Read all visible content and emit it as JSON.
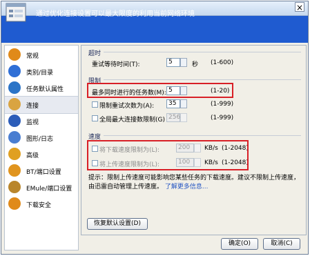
{
  "window": {
    "title": "配置",
    "close_glyph": "×"
  },
  "banner": {
    "text": "通过优化连接设置可以最大限度的利用当前网络环境",
    "icon": "settings-panel-icon"
  },
  "sidebar": {
    "items": [
      {
        "label": "常规",
        "icon": "general-icon",
        "color": "#e08a1a"
      },
      {
        "label": "类别/目录",
        "icon": "folder-icon",
        "color": "#2f6fd6"
      },
      {
        "label": "任务默认属性",
        "icon": "properties-icon",
        "color": "#2b74c7"
      },
      {
        "label": "连接",
        "icon": "connection-icon",
        "color": "#d9a441"
      },
      {
        "label": "监视",
        "icon": "monitor-icon",
        "color": "#2c5db9"
      },
      {
        "label": "图形/日志",
        "icon": "chart-icon",
        "color": "#4a7ed1"
      },
      {
        "label": "高级",
        "icon": "advanced-icon",
        "color": "#e0a021"
      },
      {
        "label": "BT/端口设置",
        "icon": "bt-icon",
        "color": "#e0941e"
      },
      {
        "label": "EMule/端口设置",
        "icon": "emule-icon",
        "color": "#b9862c"
      },
      {
        "label": "下载安全",
        "icon": "shield-icon",
        "color": "#e08a1a"
      }
    ],
    "selected_index": 3
  },
  "timeout": {
    "section": "超时",
    "retry_label": "重试等待时间(T):",
    "retry_value": "5",
    "unit": "秒",
    "range": "(1-600)"
  },
  "limits": {
    "section": "限制",
    "max_tasks_label": "最多同时进行的任务数(M):",
    "max_tasks_value": "5",
    "max_tasks_range": "(1-20)",
    "retry_limit_label": "限制重试次数为(A):",
    "retry_limit_value": "35",
    "retry_limit_range": "(1-999)",
    "global_conn_label": "全局最大连接数限制(G)",
    "global_conn_value": "256",
    "global_conn_range": "(1-999)"
  },
  "speed": {
    "section": "速度",
    "download_label": "将下载速度限制为(L):",
    "download_value": "200",
    "upload_label": "将上传速度限制为(L):",
    "upload_value": "100",
    "unit": "KB/s",
    "range": "(1-2048)"
  },
  "hint": {
    "text": "提示：限制上传速度可能影响您某些任务的下载速度。建议不限制上传速度，由迅雷自动管理上传速度。",
    "link": "了解更多信息..."
  },
  "buttons": {
    "restore": "恢复默认设置(D)",
    "ok": "确定(O)",
    "cancel": "取消(C)"
  },
  "colors": {
    "banner": "#1f5bd0",
    "highlight": "#d81f26",
    "link": "#2455c3"
  }
}
